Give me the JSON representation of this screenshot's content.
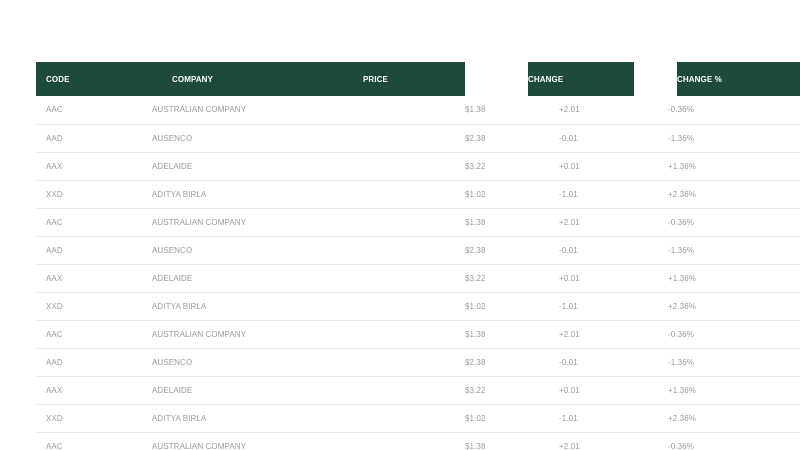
{
  "table": {
    "headers": {
      "code": "CODE",
      "company": "COMPANY",
      "price": "PRICE",
      "change": "CHANGE",
      "change_pct": "CHANGE %"
    },
    "rows": [
      {
        "code": "AAC",
        "company": "AUSTRALIAN COMPANY",
        "price": "$1.38",
        "change": "+2.01",
        "change_pct": "-0.36%"
      },
      {
        "code": "AAD",
        "company": "AUSENCO",
        "price": "$2.38",
        "change": "-0.01",
        "change_pct": "-1.36%"
      },
      {
        "code": "AAX",
        "company": "ADELAIDE",
        "price": "$3.22",
        "change": "+0.01",
        "change_pct": "+1.36%"
      },
      {
        "code": "XXD",
        "company": "ADITYA BIRLA",
        "price": "$1.02",
        "change": "-1.01",
        "change_pct": "+2.36%"
      },
      {
        "code": "AAC",
        "company": "AUSTRALIAN COMPANY",
        "price": "$1.38",
        "change": "+2.01",
        "change_pct": "-0.36%"
      },
      {
        "code": "AAD",
        "company": "AUSENCO",
        "price": "$2.38",
        "change": "-0.01",
        "change_pct": "-1.36%"
      },
      {
        "code": "AAX",
        "company": "ADELAIDE",
        "price": "$3.22",
        "change": "+0.01",
        "change_pct": "+1.36%"
      },
      {
        "code": "XXD",
        "company": "ADITYA BIRLA",
        "price": "$1.02",
        "change": "-1.01",
        "change_pct": "+2.36%"
      },
      {
        "code": "AAC",
        "company": "AUSTRALIAN COMPANY",
        "price": "$1.38",
        "change": "+2.01",
        "change_pct": "-0.36%"
      },
      {
        "code": "AAD",
        "company": "AUSENCO",
        "price": "$2.38",
        "change": "-0.01",
        "change_pct": "-1.36%"
      },
      {
        "code": "AAX",
        "company": "ADELAIDE",
        "price": "$3.22",
        "change": "+0.01",
        "change_pct": "+1.36%"
      },
      {
        "code": "XXD",
        "company": "ADITYA BIRLA",
        "price": "$1.02",
        "change": "-1.01",
        "change_pct": "+2.36%"
      },
      {
        "code": "AAC",
        "company": "AUSTRALIAN COMPANY",
        "price": "$1.38",
        "change": "+2.01",
        "change_pct": "-0.36%"
      }
    ]
  },
  "colors": {
    "header_bg": "#1e4a3c",
    "header_text": "#ffffff",
    "cell_text": "#9a9a9a",
    "row_border": "#ececec"
  }
}
